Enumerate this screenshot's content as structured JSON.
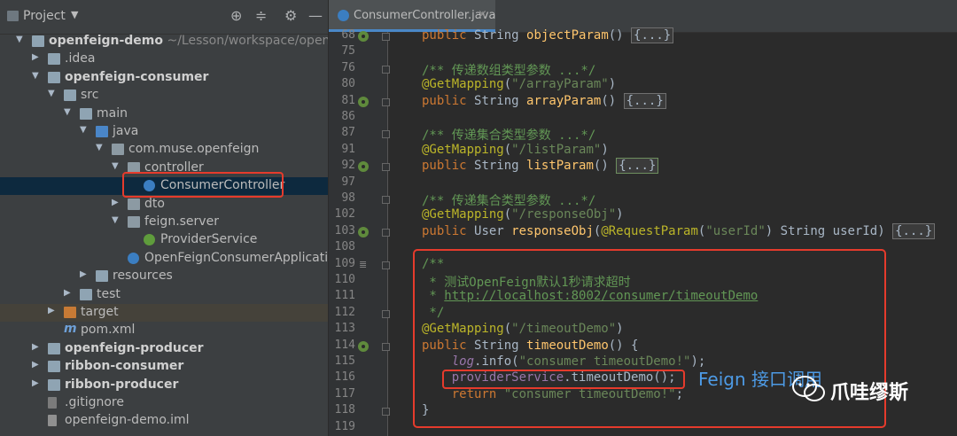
{
  "project_panel": {
    "title": "Project",
    "tree": [
      {
        "label": "openfeign-demo",
        "path": " ~/Lesson/workspace/openfeign-d",
        "depth": 0,
        "expanded": true,
        "icon": "module-folder-icon",
        "bold": true
      },
      {
        "label": ".idea",
        "depth": 1,
        "expanded": false,
        "icon": "folder-icon"
      },
      {
        "label": "openfeign-consumer",
        "depth": 1,
        "expanded": true,
        "icon": "module-folder-icon",
        "bold": true
      },
      {
        "label": "src",
        "depth": 2,
        "expanded": true,
        "icon": "folder-icon"
      },
      {
        "label": "main",
        "depth": 3,
        "expanded": true,
        "icon": "folder-icon"
      },
      {
        "label": "java",
        "depth": 4,
        "expanded": true,
        "icon": "source-folder-icon"
      },
      {
        "label": "com.muse.openfeign",
        "depth": 5,
        "expanded": true,
        "icon": "package-icon"
      },
      {
        "label": "controller",
        "depth": 6,
        "expanded": true,
        "icon": "package-icon"
      },
      {
        "label": "ConsumerController",
        "depth": 7,
        "icon": "class-icon",
        "selected": true
      },
      {
        "label": "dto",
        "depth": 6,
        "expanded": false,
        "icon": "package-icon"
      },
      {
        "label": "feign.server",
        "depth": 6,
        "expanded": true,
        "icon": "package-icon"
      },
      {
        "label": "ProviderService",
        "depth": 7,
        "icon": "interface-icon"
      },
      {
        "label": "OpenFeignConsumerApplication",
        "depth": 6,
        "icon": "spring-app-icon"
      },
      {
        "label": "resources",
        "depth": 4,
        "expanded": false,
        "icon": "resources-folder-icon"
      },
      {
        "label": "test",
        "depth": 3,
        "expanded": false,
        "icon": "folder-icon"
      },
      {
        "label": "target",
        "depth": 2,
        "expanded": false,
        "icon": "excluded-folder-icon",
        "highlight": true
      },
      {
        "label": "pom.xml",
        "depth": 2,
        "icon": "maven-icon"
      },
      {
        "label": "openfeign-producer",
        "depth": 1,
        "expanded": false,
        "icon": "module-folder-icon",
        "bold": true
      },
      {
        "label": "ribbon-consumer",
        "depth": 1,
        "expanded": false,
        "icon": "module-folder-icon",
        "bold": true
      },
      {
        "label": "ribbon-producer",
        "depth": 1,
        "expanded": false,
        "icon": "module-folder-icon",
        "bold": true
      },
      {
        "label": ".gitignore",
        "depth": 1,
        "icon": "gitignore-icon"
      },
      {
        "label": "openfeign-demo.iml",
        "depth": 1,
        "icon": "iml-icon"
      }
    ]
  },
  "editor": {
    "tab_label": "ConsumerController.java",
    "lines": [
      {
        "num": "68",
        "bean": true,
        "fold": true,
        "html": "<span class=\"kw\">public </span><span class=\"ty\">String </span><span class=\"fn\">objectParam</span>() <span class=\"collapsed\">{...}</span>"
      },
      {
        "num": "75",
        "fold": false,
        "html": ""
      },
      {
        "num": "76",
        "fold": true,
        "html": "<span class=\"cm\">/** 传递数组类型参数 ...*/</span>"
      },
      {
        "num": "80",
        "fold": false,
        "html": "<span class=\"an\">@GetMapping</span>(<span class=\"st\">\"/arrayParam\"</span>)"
      },
      {
        "num": "81",
        "bean": true,
        "fold": true,
        "html": "<span class=\"kw\">public </span><span class=\"ty\">String </span><span class=\"fn\">arrayParam</span>() <span class=\"collapsed\">{...}</span>"
      },
      {
        "num": "86",
        "fold": false,
        "html": ""
      },
      {
        "num": "87",
        "fold": true,
        "html": "<span class=\"cm\">/** 传递集合类型参数 ...*/</span>"
      },
      {
        "num": "91",
        "fold": false,
        "html": "<span class=\"an\">@GetMapping</span>(<span class=\"st\">\"/listParam\"</span>)"
      },
      {
        "num": "92",
        "bean": true,
        "fold": true,
        "html": "<span class=\"kw\">public </span><span class=\"ty\">String </span><span class=\"fn\">listParam</span>() <span class=\"collapsed hl\">{...}</span>"
      },
      {
        "num": "97",
        "fold": false,
        "html": ""
      },
      {
        "num": "98",
        "fold": true,
        "html": "<span class=\"cm\">/** 传递集合类型参数 ...*/</span>"
      },
      {
        "num": "102",
        "fold": false,
        "html": "<span class=\"an\">@GetMapping</span>(<span class=\"st\">\"/responseObj\"</span>)"
      },
      {
        "num": "103",
        "bean": true,
        "fold": true,
        "html": "<span class=\"kw\">public </span><span class=\"ty\">User </span><span class=\"fn\">responseObj</span>(<span class=\"an\">@RequestParam</span>(<span class=\"st\">\"userId\"</span>) String userId) <span class=\"collapsed\">{...}</span>"
      },
      {
        "num": "108",
        "fold": false,
        "html": ""
      },
      {
        "num": "109",
        "doc": true,
        "fold": true,
        "html": "<span class=\"cm\">/**</span>"
      },
      {
        "num": "110",
        "fold": false,
        "html": "<span class=\"cm\"> * 测试OpenFeign默认1秒请求超时</span>"
      },
      {
        "num": "111",
        "fold": false,
        "html": "<span class=\"cm\"> * </span><span class=\"lnk\">http://localhost:8002/consumer/timeoutDemo</span>"
      },
      {
        "num": "112",
        "fold": true,
        "html": "<span class=\"cm\"> */</span>"
      },
      {
        "num": "113",
        "fold": false,
        "html": "<span class=\"an\">@GetMapping</span>(<span class=\"st\">\"/timeoutDemo\"</span>)"
      },
      {
        "num": "114",
        "bean": true,
        "fold": true,
        "html": "<span class=\"kw\">public </span><span class=\"ty\">String </span><span class=\"fn\">timeoutDemo</span>() {"
      },
      {
        "num": "115",
        "fold": false,
        "html": "    <span class=\"it\">log</span>.info(<span class=\"st\">\"consumer timeoutDemo!\"</span>);"
      },
      {
        "num": "116",
        "fold": false,
        "html": "    <span class=\"it\" style=\"font-style:normal\">providerService</span>.timeoutDemo();"
      },
      {
        "num": "117",
        "fold": false,
        "html": "    <span class=\"kw\">return </span><span class=\"st\">\"consumer timeoutDemo!\"</span>;"
      },
      {
        "num": "118",
        "fold": true,
        "html": "}"
      },
      {
        "num": "119",
        "fold": false,
        "html": ""
      }
    ]
  },
  "annotation": {
    "text": "Feign 接口调用"
  },
  "watermark": {
    "text": "爪哇缪斯"
  },
  "colors": {
    "highlight_box": "#e53b2c",
    "annotation": "#4d9be6",
    "selection": "#0d293e"
  }
}
